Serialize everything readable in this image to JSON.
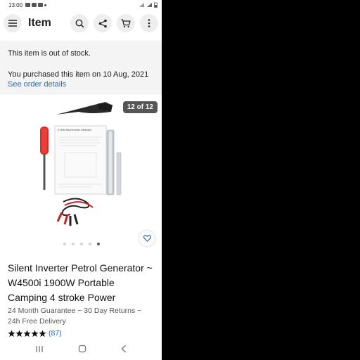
{
  "status_bar": {
    "time": "13:00"
  },
  "app_bar": {
    "title": "Item"
  },
  "notices": {
    "stock": "This item is out of stock.",
    "purchased": "You purchased this item on 10 Aug, 2021",
    "order_link": "See order details"
  },
  "gallery": {
    "counter": "12 of 12",
    "booklet_text": "2.1KW Silent Inverter Generator",
    "dots_total": 5,
    "dots_active": 4
  },
  "product": {
    "title": "Silent Inverter Petrol Generator ~ W4500i 1900W Portable Camping 4 stroke Power",
    "subtitle": "24 Month Guarantee ~ 30 Day Returns ~ 24h Free Delivery",
    "rating": 5,
    "review_count": "(87)"
  },
  "colors": {
    "link": "#2b6cb8",
    "counter_bg": "#555555",
    "notice_bg": "#f4f4f4"
  }
}
